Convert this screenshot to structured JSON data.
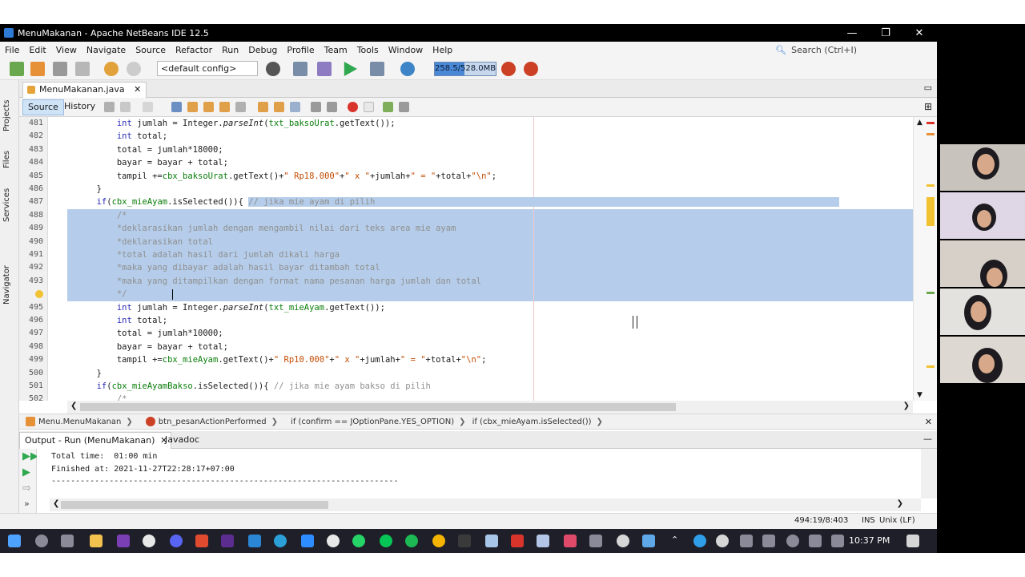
{
  "window": {
    "title": "MenuMakanan - Apache NetBeans IDE 12.5",
    "minimize": "—",
    "restore": "❐",
    "close": "✕"
  },
  "menu": [
    "File",
    "Edit",
    "View",
    "Navigate",
    "Source",
    "Refactor",
    "Run",
    "Debug",
    "Profile",
    "Team",
    "Tools",
    "Window",
    "Help"
  ],
  "search": {
    "placeholder": "Search (Ctrl+I)"
  },
  "toolbar": {
    "config": "<default config>",
    "memory": "258.5/528.0MB",
    "memory_fraction": 0.49
  },
  "sidebar": [
    "Projects",
    "Files",
    "Services",
    "Navigator"
  ],
  "editor": {
    "file_tab": "MenuMakanan.java",
    "source_tab": "Source",
    "history_tab": "History",
    "lines": [
      {
        "n": "481",
        "text": "            int jumlah = Integer.parseInt(txt_baksoUrat.getText());"
      },
      {
        "n": "482",
        "text": "            int total;"
      },
      {
        "n": "483",
        "text": "            total = jumlah*18000;"
      },
      {
        "n": "484",
        "text": "            bayar = bayar + total;"
      },
      {
        "n": "485",
        "text": "            tampil +=cbx_baksoUrat.getText()+\" Rp18.000\"+\" x \"+jumlah+\" = \"+total+\"\\n\";"
      },
      {
        "n": "486",
        "text": "        }"
      },
      {
        "n": "487",
        "text": "        if(cbx_mieAyam.isSelected()){ // jika mie ayam di pilih"
      },
      {
        "n": "488",
        "text": "            /*"
      },
      {
        "n": "489",
        "text": "            *deklarasikan jumlah dengan mengambil nilai dari teks area mie ayam"
      },
      {
        "n": "490",
        "text": "            *deklarasikan total"
      },
      {
        "n": "491",
        "text": "            *total adalah hasil dari jumlah dikali harga"
      },
      {
        "n": "492",
        "text": "            *maka yang dibayar adalah hasil bayar ditambah total"
      },
      {
        "n": "493",
        "text": "            *maka yang ditampilkan dengan format nama pesanan harga jumlah dan total"
      },
      {
        "n": "",
        "text": "            */"
      },
      {
        "n": "495",
        "text": "            int jumlah = Integer.parseInt(txt_mieAyam.getText());"
      },
      {
        "n": "496",
        "text": "            int total;"
      },
      {
        "n": "497",
        "text": "            total = jumlah*10000;"
      },
      {
        "n": "498",
        "text": "            bayar = bayar + total;"
      },
      {
        "n": "499",
        "text": "            tampil +=cbx_mieAyam.getText()+\" Rp10.000\"+\" x \"+jumlah+\" = \"+total+\"\\n\";"
      },
      {
        "n": "500",
        "text": "        }"
      },
      {
        "n": "501",
        "text": "        if(cbx_mieAyamBakso.isSelected()){ // jika mie ayam bakso di pilih"
      },
      {
        "n": "502",
        "text": "            /*"
      }
    ]
  },
  "breadcrumbs": [
    "Menu.MenuMakanan",
    "btn_pesanActionPerformed",
    "if (confirm == JOptionPane.YES_OPTION)",
    "if (cbx_mieAyam.isSelected())"
  ],
  "output": {
    "tab": "Output - Run (MenuMakanan)",
    "javadoc_tab": "Javadoc",
    "lines": [
      "Total time:  01:00 min",
      "Finished at: 2021-11-27T22:28:17+07:00",
      "------------------------------------------------------------------------"
    ]
  },
  "status": {
    "position": "494:19/8:403",
    "mode": "INS",
    "line_ending": "Unix (LF)"
  },
  "taskbar": {
    "time": "10:37 PM"
  }
}
